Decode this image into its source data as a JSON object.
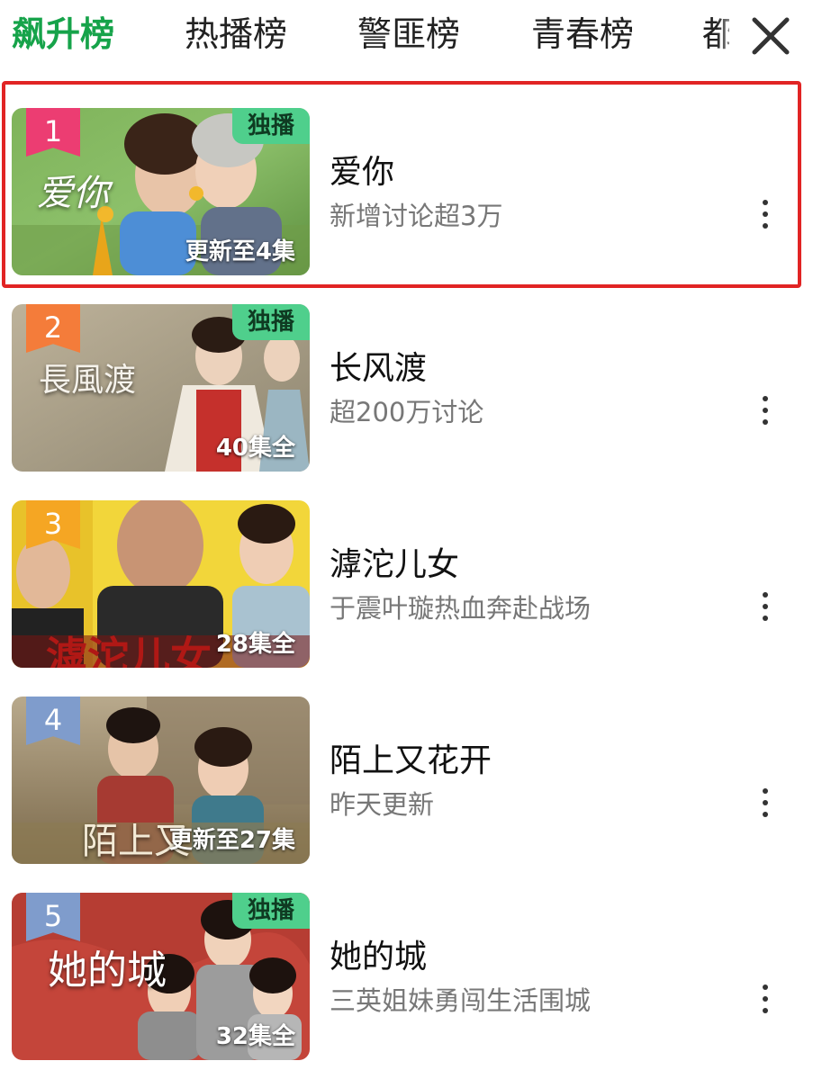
{
  "tabs": [
    {
      "label": "飙升榜",
      "active": true
    },
    {
      "label": "热播榜",
      "active": false
    },
    {
      "label": "警匪榜",
      "active": false
    },
    {
      "label": "青春榜",
      "active": false
    },
    {
      "label": "都",
      "active": false
    }
  ],
  "close_icon": "close-icon",
  "accent_color": "#16a34a",
  "highlight_color": "#e12424",
  "items": [
    {
      "rank": "1",
      "title": "爱你",
      "subtitle": "新增讨论超3万",
      "badge": "独播",
      "episodes": "更新至4集",
      "poster_art": "爱你"
    },
    {
      "rank": "2",
      "title": "长风渡",
      "subtitle": "超200万讨论",
      "badge": "独播",
      "episodes": "40集全",
      "poster_art": "長風渡"
    },
    {
      "rank": "3",
      "title": "滹沱儿女",
      "subtitle": "于震叶璇热血奔赴战场",
      "badge": "",
      "episodes": "28集全",
      "poster_art": "滹沱儿女"
    },
    {
      "rank": "4",
      "title": "陌上又花开",
      "subtitle": "昨天更新",
      "badge": "",
      "episodes": "更新至27集",
      "poster_art": "陌上又"
    },
    {
      "rank": "5",
      "title": "她的城",
      "subtitle": "三英姐妹勇闯生活围城",
      "badge": "独播",
      "episodes": "32集全",
      "poster_art": "她的城"
    }
  ],
  "more_icon": "more-vertical-icon"
}
